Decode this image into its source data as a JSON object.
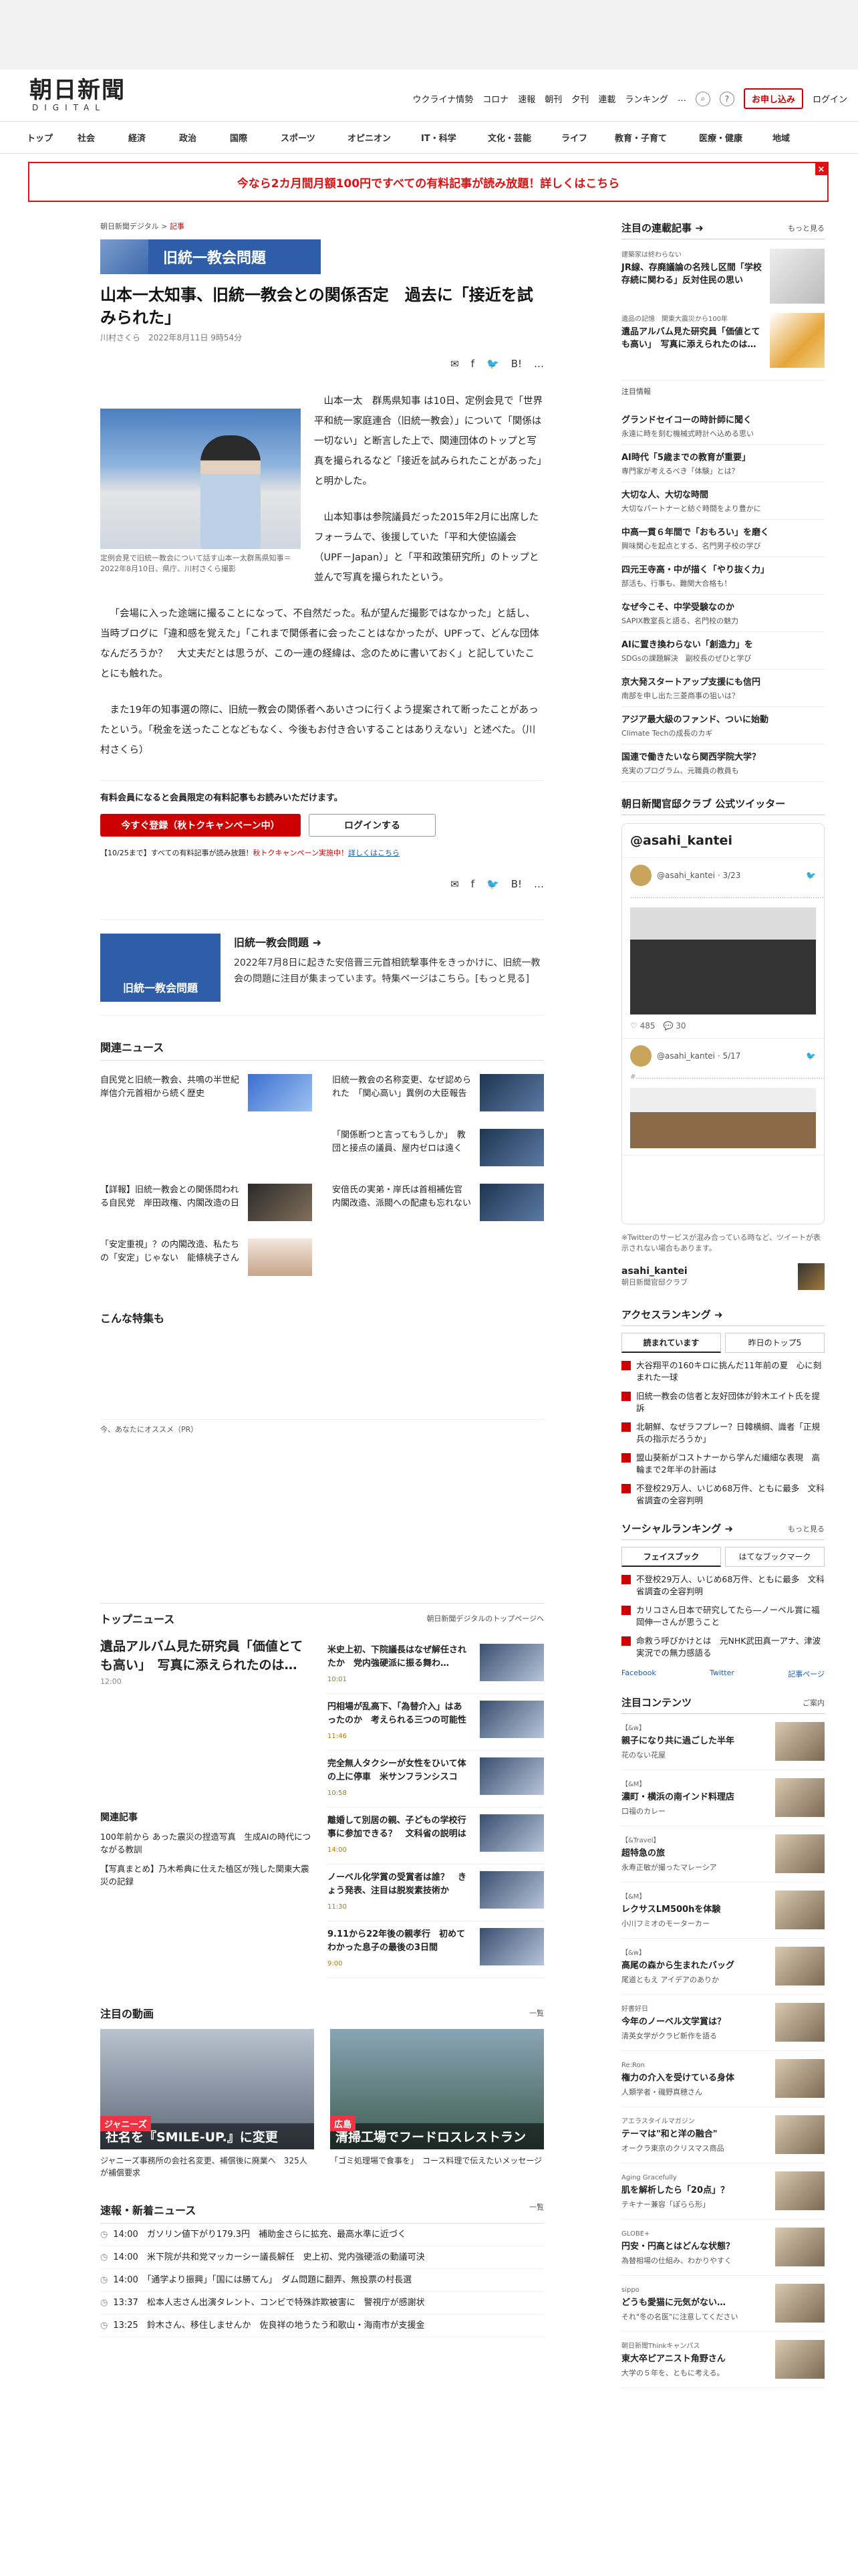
{
  "header": {
    "logo_ja": "朝日新聞",
    "logo_en": "DIGITAL",
    "util_links": [
      "ウクライナ情勢",
      "コロナ",
      "速報",
      "朝刊",
      "夕刊",
      "連載",
      "ランキング"
    ],
    "more": "…",
    "subscribe": "お申し込み",
    "login": "ログイン"
  },
  "gnav": [
    "トップ",
    "社会",
    "経済",
    "政治",
    "国際",
    "スポーツ",
    "オピニオン",
    "IT・科学",
    "文化・芸能",
    "ライフ",
    "教育・子育て",
    "医療・健康",
    "地域"
  ],
  "banner": {
    "text": "今なら2カ月間月額100円ですべての有料記事が読み放題！詳しくはこちら",
    "close": "×"
  },
  "article": {
    "crumb_site": "朝日新聞デジタル",
    "crumb_sep": ">",
    "crumb_cat": "記事",
    "tag": "旧統一教会問題",
    "title": "山本一太知事、旧統一教会との関係否定　過去に「接近を試みられた」",
    "author_date": "川村さくら　2022年8月11日 9時54分",
    "share": {
      "mail": "✉",
      "fb": "f",
      "tw": "🐦",
      "hb": "B!",
      "more": "…",
      "list": "list"
    },
    "photo_caption": "定例会見で旧統一教会について話す山本一太群馬県知事＝2022年8月10日、県庁、川村さくら撮影",
    "paragraphs": [
      "山本一太　群馬県知事 は10日、定例会見で「世界平和統一家庭連合（旧統一教会）」について「関係は一切ない」と断言した上で、関連団体のトップと写真を撮られるなど「接近を試みられたことがあった」と明かした。",
      "山本知事は参院議員だった2015年2月に出席したフォーラムで、後援していた「平和大使協議会（UPF－Japan）」と「平和政策研究所」のトップと並んで写真を撮られたという。",
      "「会場に入った途端に撮ることになって、不自然だった。私が望んだ撮影ではなかった」と話し、当時ブログに「違和感を覚えた」「これまで関係者に会ったことはなかったが、UPFって、どんな団体なんだろうか？　大丈夫だとは思うが、この一連の経緯は、念のために書いておく」と記していたことにも触れた。",
      "また19年の知事選の際に、旧統一教会の関係者へあいさつに行くよう提案されて断ったことがあったという。「税金を送ったことなどもなく、今後もお付き合いすることはありえない」と述べた。（川村さくら）"
    ],
    "member_text": "有料会員になると会員限定の有料記事もお読みいただけます。",
    "register": "今すぐ登録（秋トクキャンペーン中）",
    "login": "ログインする",
    "campaign_pre": "【10/25まで】すべての有料記事が読み放題！",
    "campaign_red": "秋トクキャンペーン実施中！",
    "campaign_link": "詳しくはこちら"
  },
  "series": {
    "img_label": "旧統一教会問題",
    "title": "旧統一教会問題 ➜",
    "desc": "2022年7月8日に起きた安倍晋三元首相銃撃事件をきっかけに、旧統一教会の問題に注目が集まっています。特集ページはこちら。[もっと見る]"
  },
  "related": {
    "title": "関連ニュース",
    "items": [
      {
        "text": "自民党と旧統一教会、共鳴の半世紀　岸信介元首相から続く歴史"
      },
      {
        "text": "旧統一教会の名称変更、なぜ認められた　「関心高い」異例の大臣報告"
      },
      {
        "text": ""
      },
      {
        "text": "「関係断つと言ってもうしか」　教団と接点の議員、屋内ゼロは遠く"
      },
      {
        "text": "【詳報】旧統一教会との関係問われる自民党　岸田政権、内閣改造の日"
      },
      {
        "text": "安倍氏の実弟・岸氏は首相補佐官　内閣改造、派閥への配慮も忘れない"
      },
      {
        "text": "「安定重視」？の内閣改造、私たちの「安定」じゃない　能條桃子さん"
      }
    ]
  },
  "special_title": "こんな特集も",
  "recommend": "今、あなたにオススメ（PR）",
  "topnews": {
    "title": "トップニュース",
    "right": "朝日新聞デジタルのトップページへ",
    "lead": "遺品アルバム見た研究員「価値とても高い」　写真に添えられたのは…",
    "lead_time": "12:00",
    "related_title": "関連記事",
    "related_items": [
      "100年前から あった震災の捏造写真　生成AIの時代につながる教訓",
      "【写真まとめ】乃木希典に仕えた植区が残した関東大震災の記録"
    ],
    "items": [
      {
        "text": "米史上初、下院議長はなぜ解任されたか　党内強硬派に振る舞わ…",
        "time": "10:01"
      },
      {
        "text": "円相場が乱高下、「為替介入」はあったのか　考えられる三つの可能性",
        "time": "11:46"
      },
      {
        "text": "完全無人タクシーが女性をひいて体の上に停車　米サンフランシスコ",
        "time": "10:58"
      },
      {
        "text": "離婚して別居の親、子どもの学校行事に参加できる？　文科省の説明は",
        "time": "14:00"
      },
      {
        "text": "ノーベル化学賞の受賞者は誰？　きょう発表、注目は脱炭素技術か",
        "time": "11:30"
      },
      {
        "text": "9.11から22年後の親孝行　初めてわかった息子の最後の3日間",
        "time": "9:00"
      }
    ]
  },
  "videos": {
    "title": "注目の動画",
    "right": "一覧",
    "items": [
      {
        "tag": "ジャニーズ",
        "caption": "社名を『SMILE-UP.』に変更",
        "desc": "ジャニーズ事務所の会社名変更、補償後に廃業へ　325人が補償要求"
      },
      {
        "tag": "広島",
        "caption": "清掃工場でフードロスレストラン",
        "desc": "「ゴミ処理場で食事を」　コース料理で伝えたいメッセージ"
      }
    ]
  },
  "breaking": {
    "title": "速報・新着ニュース",
    "right": "一覧",
    "items": [
      {
        "time": "14:00",
        "text": "ガソリン値下がり179.3円　補助金さらに拡充、最高水準に近づく"
      },
      {
        "time": "14:00",
        "text": "米下院が共和党マッカーシー議長解任　史上初、党内強硬派の動議可決"
      },
      {
        "time": "14:00",
        "text": "「通学より振興」「国には勝てん」　ダム問題に翻弄、無投票の村長選"
      },
      {
        "time": "13:37",
        "text": "松本人志さん出演タレント、コンビで特殊詐欺被害に　警視庁が感謝状"
      },
      {
        "time": "13:25",
        "text": "鈴木さん、移住しませんか　佐良祥の地うたう和歌山・海南市が支援金"
      }
    ]
  },
  "sidebar": {
    "serial_title": "注目の連載記事 ➜",
    "more": "もっと見る",
    "features": [
      {
        "sub": "建築家は終わらない",
        "text": "JR線、存廃議論の名残し区間「学校存続に関わる」反対住民の思い"
      },
      {
        "sub": "遺品の記憶　関東大震災から100年",
        "text": "遺品アルバム見た研究員「価値とても高い」　写真に添えられたのは…"
      }
    ],
    "note": "注目情報",
    "list": [
      {
        "t": "グランドセイコーの時計師に聞く",
        "s": "永遠に時を刻む機械式時計へ込める思い"
      },
      {
        "t": "AI時代「5歳までの教育が重要」",
        "s": "専門家が考えるべき「体験」とは？"
      },
      {
        "t": "大切な人、大切な時間",
        "s": "大切なパートナーと紡ぐ時間をより豊かに"
      },
      {
        "t": "中高一貫６年間で「おもろい」を磨く",
        "s": "興味関心を起点とする、名門男子校の学び"
      },
      {
        "t": "四元王寺高・中が描く「やり抜く力」",
        "s": "部活も、行事も、難関大合格も！"
      },
      {
        "t": "なぜ今こそ、中学受験なのか",
        "s": "SAPIX教室長と語る、名門校の魅力"
      },
      {
        "t": "AIに置き換わらない「創造力」を",
        "s": "SDGsの課題解決　副校長のぜひと学び"
      },
      {
        "t": "京大発スタートアップ支援にも信円",
        "s": "南部を申し出た三菱商事の狙いは？"
      },
      {
        "t": "アジア最大級のファンド、ついに始動",
        "s": "Climate Techの成長のカギ"
      },
      {
        "t": "国連で働きたいなら関西学院大学？",
        "s": "充実のプログラム、元職員の教員も"
      }
    ],
    "twitter_title": "朝日新聞官邸クラブ 公式ツイッター",
    "twitter_handle": "@asahi_kantei",
    "tweets": [
      {
        "user": "@asahi_kantei · 3/23",
        "body": "……………………………………………………………………………………"
      },
      {
        "user": "@asahi_kantei · 5/17",
        "body": "#……………………………………………………………………………"
      }
    ],
    "tweet_actions": "♡ 485　💬 30",
    "twitter_foot": "※Twitterのサービスが混み合っている時など、ツイートが表示されない場合もあります。",
    "acct_name": "asahi_kantei",
    "acct_sub": "朝日新聞官邸クラブ",
    "access_title": "アクセスランキング ➜",
    "access_tabs": [
      "読まれています",
      "昨日のトップ5"
    ],
    "access_items": [
      "大谷翔平の160キロに挑んだ11年前の夏　心に刻まれた一球",
      "旧統一教会の信者と友好団体が鈴木エイト氏を提訴",
      "北朝鮮、なぜラフプレー？日韓横綱、識者「正規兵の指示だろうか」",
      "盟山葵新がコストナーから学んだ繊細な表現　高輪まで2年半の計画は",
      "不登校29万人、いじめ68万件、ともに最多　文科省調査の全容判明"
    ],
    "social_title": "ソーシャルランキング ➜",
    "social_tabs": [
      "フェイスブック",
      "はてなブックマーク"
    ],
    "social_items": [
      "不登校29万人、いじめ68万件、ともに最多　文科省調査の全容判明",
      "カリコさん日本で研究してたら―ノーベル賞に福岡伸一さんが思うこと",
      "命救う呼びかけとは　元NHK武田真一アナ、津波実況での無力感語る"
    ],
    "social_links": [
      "Facebook",
      "Twitter",
      "記事ページ"
    ],
    "content_title": "注目コンテンツ",
    "content_right": "ご案内",
    "content_items": [
      {
        "tag": "【&w】",
        "t": "親子になり共に過ごした半年",
        "s": "花のない花屋"
      },
      {
        "tag": "【&M】",
        "t": "濃町・横浜の南インド料理店",
        "s": "口福のカレー"
      },
      {
        "tag": "【&Travel】",
        "t": "超特急の旅",
        "s": "永寿正敏が撮ったマレーシア"
      },
      {
        "tag": "【&M】",
        "t": "レクサスLM500hを体験",
        "s": "小川フミオのモーターカー"
      },
      {
        "tag": "【&w】",
        "t": "高尾の森から生まれたバッグ",
        "s": "尾道ともえ アイデアのありか"
      },
      {
        "tag": "好書好日",
        "t": "今年のノーベル文学賞は？",
        "s": "清英女学がクラビ新作を語る"
      },
      {
        "tag": "Re:Ron",
        "t": "権力の介入を受けている身体",
        "s": "人類学者・磯野真穂さん"
      },
      {
        "tag": "アエラスタイルマガジン",
        "t": "テーマは\"和と洋の融合\"",
        "s": "オークラ東京のクリスマス商品"
      },
      {
        "tag": "Aging Gracefully",
        "t": "肌を解析したら「20点」？",
        "s": "テキナー兼容「ぽらら形」"
      },
      {
        "tag": "GLOBE+",
        "t": "円安・円高とはどんな状態？",
        "s": "為替相場の仕組み、わかりやすく"
      },
      {
        "tag": "sippo",
        "t": "どうも愛猫に元気がない…",
        "s": "それ\"冬の名医\"に注意してください"
      },
      {
        "tag": "朝日新聞Thinkキャンパス",
        "t": "東大卒ピアニスト角野さん",
        "s": "大学の５年を、ともに考える。"
      }
    ]
  }
}
